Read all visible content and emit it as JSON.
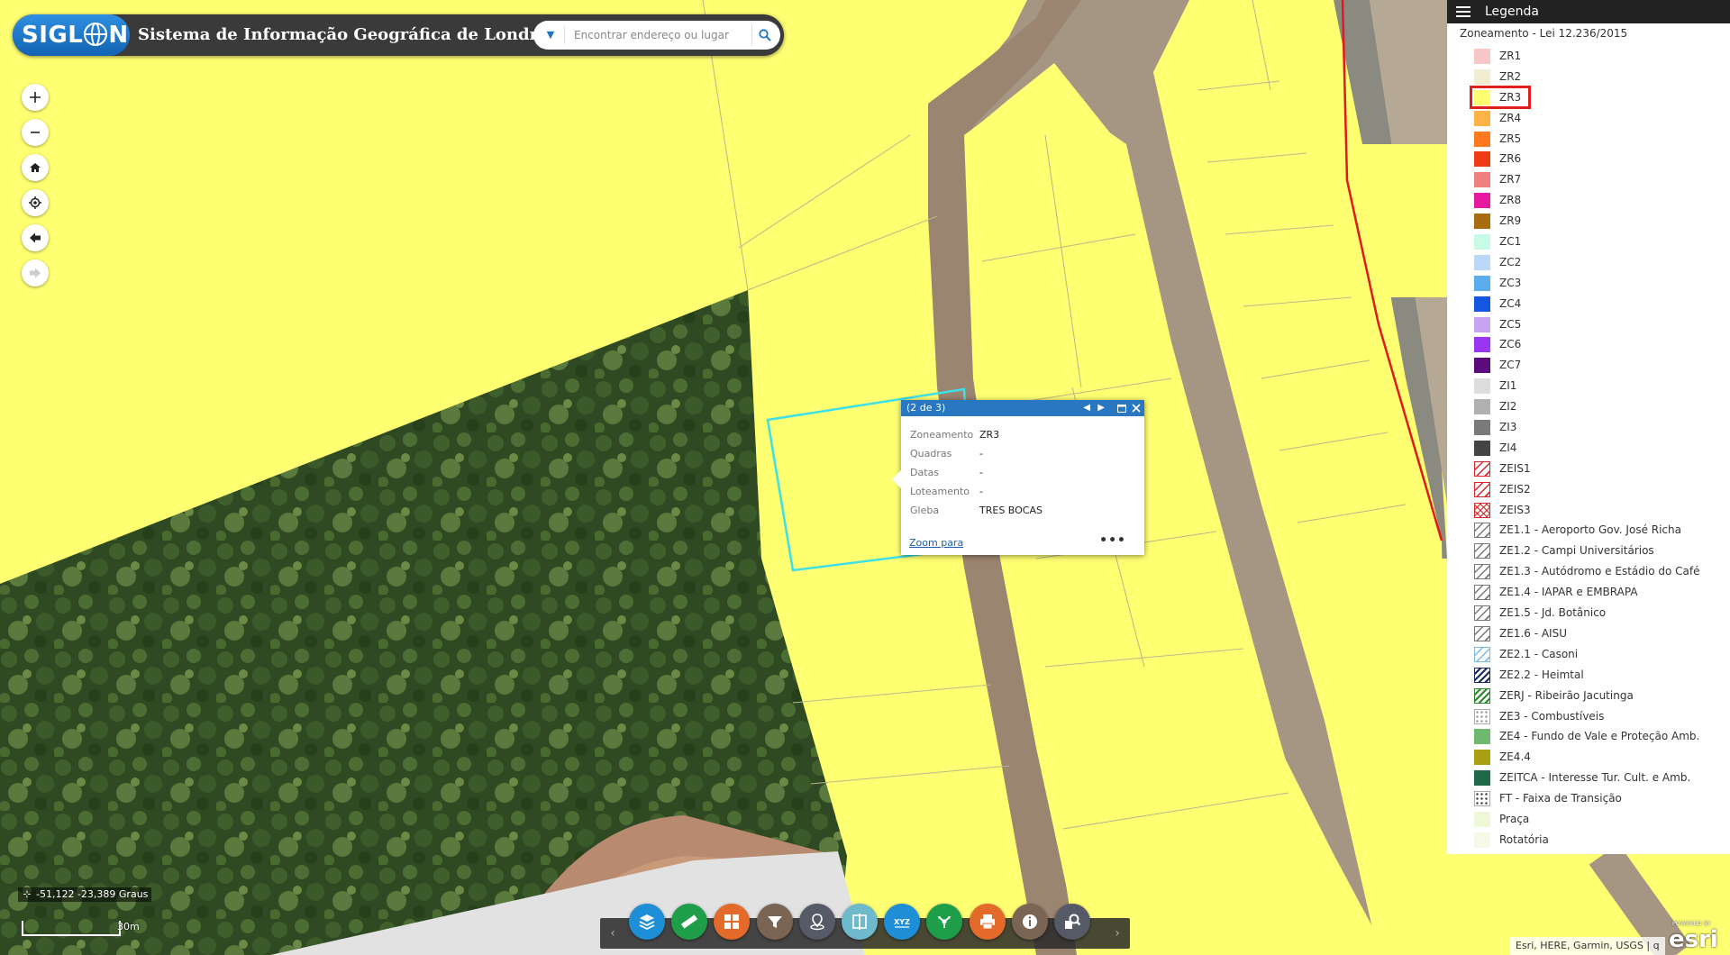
{
  "header": {
    "logo_text": "SIGL",
    "logo_text_end": "N",
    "title": "Sistema de Informação Geográfica de Londrina",
    "search_placeholder": "Encontrar endereço ou lugar"
  },
  "nav_icons": [
    "zoom-in-icon",
    "zoom-out-icon",
    "home-icon",
    "locate-icon",
    "back-icon",
    "forward-icon"
  ],
  "legend": {
    "title": "Legenda",
    "layer_title": "Zoneamento - Lei 12.236/2015",
    "items": [
      {
        "label": "ZR1",
        "color": "#f7c6c6",
        "style": "solid"
      },
      {
        "label": "ZR2",
        "color": "#f2ecd0",
        "style": "solid"
      },
      {
        "label": "ZR3",
        "color": "#ffff72",
        "style": "solid",
        "highlighted": true
      },
      {
        "label": "ZR4",
        "color": "#ffb347",
        "style": "solid"
      },
      {
        "label": "ZR5",
        "color": "#ff7a1f",
        "style": "solid"
      },
      {
        "label": "ZR6",
        "color": "#ef3a16",
        "style": "solid"
      },
      {
        "label": "ZR7",
        "color": "#f08080",
        "style": "solid"
      },
      {
        "label": "ZR8",
        "color": "#e51aa0",
        "style": "solid"
      },
      {
        "label": "ZR9",
        "color": "#a86b10",
        "style": "solid"
      },
      {
        "label": "ZC1",
        "color": "#c8fbe6",
        "style": "solid"
      },
      {
        "label": "ZC2",
        "color": "#bcd8f7",
        "style": "solid"
      },
      {
        "label": "ZC3",
        "color": "#5aaef0",
        "style": "solid"
      },
      {
        "label": "ZC4",
        "color": "#1456e0",
        "style": "solid"
      },
      {
        "label": "ZC5",
        "color": "#c6a4f2",
        "style": "solid"
      },
      {
        "label": "ZC6",
        "color": "#9a36f2",
        "style": "solid"
      },
      {
        "label": "ZC7",
        "color": "#5a0c7a",
        "style": "solid"
      },
      {
        "label": "ZI1",
        "color": "#dddddd",
        "style": "solid"
      },
      {
        "label": "ZI2",
        "color": "#b0b0b0",
        "style": "solid"
      },
      {
        "label": "ZI3",
        "color": "#7a7a7a",
        "style": "solid"
      },
      {
        "label": "ZI4",
        "color": "#444444",
        "style": "solid"
      },
      {
        "label": "ZEIS1",
        "color": "#d9262a",
        "style": "hatch"
      },
      {
        "label": "ZEIS2",
        "color": "#d9262a",
        "style": "hatch"
      },
      {
        "label": "ZEIS3",
        "color": "#d9262a",
        "style": "crosshatch"
      },
      {
        "label": "ZE1.1 - Aeroporto Gov. José Richa",
        "color": "#777777",
        "style": "hatch"
      },
      {
        "label": "ZE1.2 - Campi Universitários",
        "color": "#777777",
        "style": "hatch"
      },
      {
        "label": "ZE1.3 - Autódromo e Estádio do Café",
        "color": "#777777",
        "style": "hatch"
      },
      {
        "label": "ZE1.4 - IAPAR e EMBRAPA",
        "color": "#777777",
        "style": "hatch"
      },
      {
        "label": "ZE1.5 - Jd. Botânico",
        "color": "#777777",
        "style": "hatch"
      },
      {
        "label": "ZE1.6 - AISU",
        "color": "#777777",
        "style": "hatch"
      },
      {
        "label": "ZE2.1 - Casoni",
        "color": "#7ab8e8",
        "style": "hatch"
      },
      {
        "label": "ZE2.2 - Heimtal",
        "color": "#1a2a66",
        "style": "hatch-dense"
      },
      {
        "label": "ZERJ - Ribeirão Jacutinga",
        "color": "#2a8a2a",
        "style": "hatch-dense"
      },
      {
        "label": "ZE3 - Combustíveis",
        "color": "#999999",
        "style": "dots"
      },
      {
        "label": "ZE4 - Fundo de Vale e Proteção Amb.",
        "color": "#6fb86f",
        "style": "solid"
      },
      {
        "label": "ZE4.4",
        "color": "#a8a010",
        "style": "solid"
      },
      {
        "label": "ZEITCA - Interesse Tur. Cult. e Amb.",
        "color": "#1e6a4a",
        "style": "solid"
      },
      {
        "label": "FT - Faixa de Transição",
        "color": "#444444",
        "style": "dots"
      },
      {
        "label": "Praça",
        "color": "#eef7d8",
        "style": "solid"
      },
      {
        "label": "Rotatória",
        "color": "#f5f9e8",
        "style": "solid"
      }
    ]
  },
  "popup": {
    "counter": "(2 de 3)",
    "fields": [
      {
        "label": "Zoneamento",
        "value": "ZR3"
      },
      {
        "label": "Quadras",
        "value": "-"
      },
      {
        "label": "Datas",
        "value": "-"
      },
      {
        "label": "Loteamento",
        "value": "-"
      },
      {
        "label": "Gleba",
        "value": "TRES BOCAS"
      }
    ],
    "zoom_link": "Zoom para",
    "more": "•••"
  },
  "status": {
    "coordinates": "-51,122 -23,389 Graus",
    "scale_label": "30m",
    "attribution": "Esri, HERE, Garmin, USGS | q",
    "esri_powered": "POWERED BY",
    "esri_name": "esri"
  },
  "toolbar": {
    "tools": [
      {
        "name": "layers-icon",
        "color": "#1e8fd6"
      },
      {
        "name": "measure-icon",
        "color": "#1f9e4a"
      },
      {
        "name": "basemap-gallery-icon",
        "color": "#e46a2a"
      },
      {
        "name": "filter-icon",
        "color": "#7a6554"
      },
      {
        "name": "location-pin-icon",
        "color": "#555a66"
      },
      {
        "name": "swipe-icon",
        "color": "#6fb9cc"
      },
      {
        "name": "xyz-coordinates-icon",
        "color": "#1e8fd6"
      },
      {
        "name": "share-icon",
        "color": "#1f9e4a"
      },
      {
        "name": "print-icon",
        "color": "#e46a2a"
      },
      {
        "name": "info-icon",
        "color": "#7a6554"
      },
      {
        "name": "query-icon",
        "color": "#555a66"
      }
    ]
  }
}
